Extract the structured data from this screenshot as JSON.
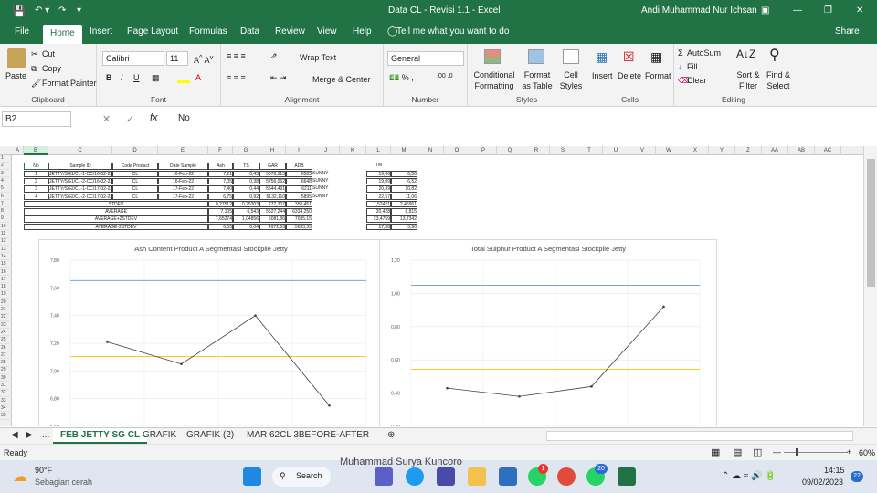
{
  "window": {
    "title": "Data CL - Revisi 1.1  -  Excel",
    "user": "Andi Muhammad Nur Ichsan"
  },
  "menu": {
    "items": [
      "File",
      "Home",
      "Insert",
      "Page Layout",
      "Formulas",
      "Data",
      "Review",
      "View",
      "Help"
    ],
    "tell_me": "Tell me what you want to do",
    "share": "Share"
  },
  "ribbon": {
    "clipboard": {
      "paste": "Paste",
      "cut": "Cut",
      "copy": "Copy",
      "format_painter": "Format Painter",
      "label": "Clipboard"
    },
    "font": {
      "name": "Calibri",
      "size": "11",
      "label": "Font"
    },
    "alignment": {
      "wrap": "Wrap Text",
      "merge": "Merge & Center",
      "label": "Alignment"
    },
    "number": {
      "format": "General",
      "label": "Number"
    },
    "styles": {
      "conditional": "Conditional Formatting",
      "format_as": "Format as Table",
      "cell_styles": "Cell Styles",
      "label": "Styles"
    },
    "cells": {
      "insert": "Insert",
      "delete": "Delete",
      "format": "Format",
      "label": "Cells"
    },
    "editing": {
      "autosum": "AutoSum",
      "fill": "Fill",
      "clear": "Clear",
      "sort": "Sort & Filter",
      "find": "Find & Select",
      "label": "Editing"
    }
  },
  "formula_bar": {
    "name_box": "B2",
    "fx": "fx",
    "content": "No"
  },
  "columns": [
    "A",
    "B",
    "C",
    "D",
    "E",
    "F",
    "G",
    "H",
    "I",
    "J",
    "K",
    "L",
    "M",
    "N",
    "O",
    "P",
    "Q",
    "R",
    "S",
    "T",
    "U",
    "V",
    "W",
    "X",
    "Y",
    "Z",
    "AA",
    "AB",
    "AC"
  ],
  "rows": [
    "1",
    "2",
    "3",
    "4",
    "5",
    "6",
    "7",
    "8",
    "9",
    "10",
    "11",
    "12",
    "13",
    "14",
    "15",
    "16",
    "17",
    "18",
    "19",
    "20",
    "21",
    "22",
    "23",
    "24",
    "25",
    "26",
    "27",
    "28",
    "29",
    "30",
    "31",
    "32",
    "33",
    "34",
    "35"
  ],
  "table": {
    "headers": [
      "No",
      "Sample ID",
      "Code Product",
      "Date Sample",
      "Ash",
      "TS",
      "GAR",
      "ADB"
    ],
    "rows": [
      [
        "1",
        "JETTY/SG1/CL-1-CC/16-02-22",
        "CL",
        "16-Feb-22",
        "7,21",
        "0,43",
        "5678,315",
        "6583",
        "SUNNY"
      ],
      [
        "2",
        "JETTY/SG1/CL-2-CC/16-02-22",
        "CL",
        "16-Feb-22",
        "7,05",
        "0,38",
        "5756,062",
        "6648",
        "SUNNY"
      ],
      [
        "3",
        "JETTY/SG2/CL-1-CC/17-02-22",
        "CL",
        "17-Feb-22",
        "7,40",
        "0,44",
        "5544,491",
        "6211",
        "SUNNY"
      ],
      [
        "4",
        "JETTY/SG2/CL-2-CC/17-02-22",
        "CL",
        "17-Feb-22",
        "6,75",
        "0,92",
        "5132,110",
        "5895",
        "SUNNY"
      ]
    ],
    "stats": [
      [
        "STDEV",
        "0,27512",
        "0,25303",
        "277,307",
        "350,451"
      ],
      [
        "AVERAGE",
        "7,105",
        "0,543",
        "5527,244",
        "6334,250"
      ],
      [
        "AVERAGE+2STDEV",
        "7,65274",
        "1,04856",
        "6081,86",
        "7035,15"
      ],
      [
        "AVERAGE-2STDEV",
        "6,55",
        "0,04",
        "4972,63",
        "5633,35"
      ]
    ],
    "tm_header": "TM",
    "tm_rows": [
      [
        "19,66",
        "6,86"
      ],
      [
        "19,09",
        "6,52"
      ],
      [
        "20,39",
        "10,82"
      ],
      [
        "22,57",
        "11,06"
      ],
      [
        "1,52421",
        "2,45961"
      ],
      [
        "20,428",
        "8,815"
      ],
      [
        "23,4759",
        "13,7342"
      ],
      [
        "17,38",
        "3,90"
      ]
    ]
  },
  "chart_data": [
    {
      "type": "line",
      "title": "Ash Content Product A Segmentasi Stockpile Jetty",
      "yticks": [
        "7,80",
        "7,60",
        "7,40",
        "7,20",
        "7,00",
        "6,80",
        "6,60"
      ],
      "ylim": [
        6.6,
        7.8
      ],
      "values": [
        7.21,
        7.05,
        7.4,
        6.75
      ],
      "ref_lines": [
        {
          "value": 7.65274,
          "color": "#5b9bd5"
        },
        {
          "value": 7.105,
          "color": "#ffc000"
        },
        {
          "value": 6.55,
          "color": "#ff0000"
        }
      ]
    },
    {
      "type": "line",
      "title": "Total Sulphur Product A Segmentasi Stockpile Jetty",
      "yticks": [
        "1,20",
        "1,00",
        "0,80",
        "0,60",
        "0,40",
        "0,20"
      ],
      "ylim": [
        0.2,
        1.2
      ],
      "values": [
        0.43,
        0.38,
        0.44,
        0.92
      ],
      "ref_lines": [
        {
          "value": 1.04856,
          "color": "#5b9bd5"
        },
        {
          "value": 0.543,
          "color": "#ffc000"
        },
        {
          "value": 0.04,
          "color": "#ff0000"
        }
      ]
    }
  ],
  "sheet_tabs": {
    "ellipsis": "...",
    "items": [
      "FEB JETTY SG CL",
      "GRAFIK",
      "GRAFIK (2)",
      "MAR 62CL 3BEFORE-AFTER"
    ],
    "active": "FEB JETTY SG CL"
  },
  "statusbar": {
    "ready": "Ready",
    "zoom": "60%"
  },
  "taskbar": {
    "weather_temp": "90°F",
    "weather_desc": "Sebagian cerah",
    "search": "Search",
    "time": "14:15",
    "date": "09/02/2023",
    "badge_wa": "1",
    "badge_20": "20",
    "notif": "22",
    "tooltip": "Muhammad Surya Kuncoro"
  }
}
